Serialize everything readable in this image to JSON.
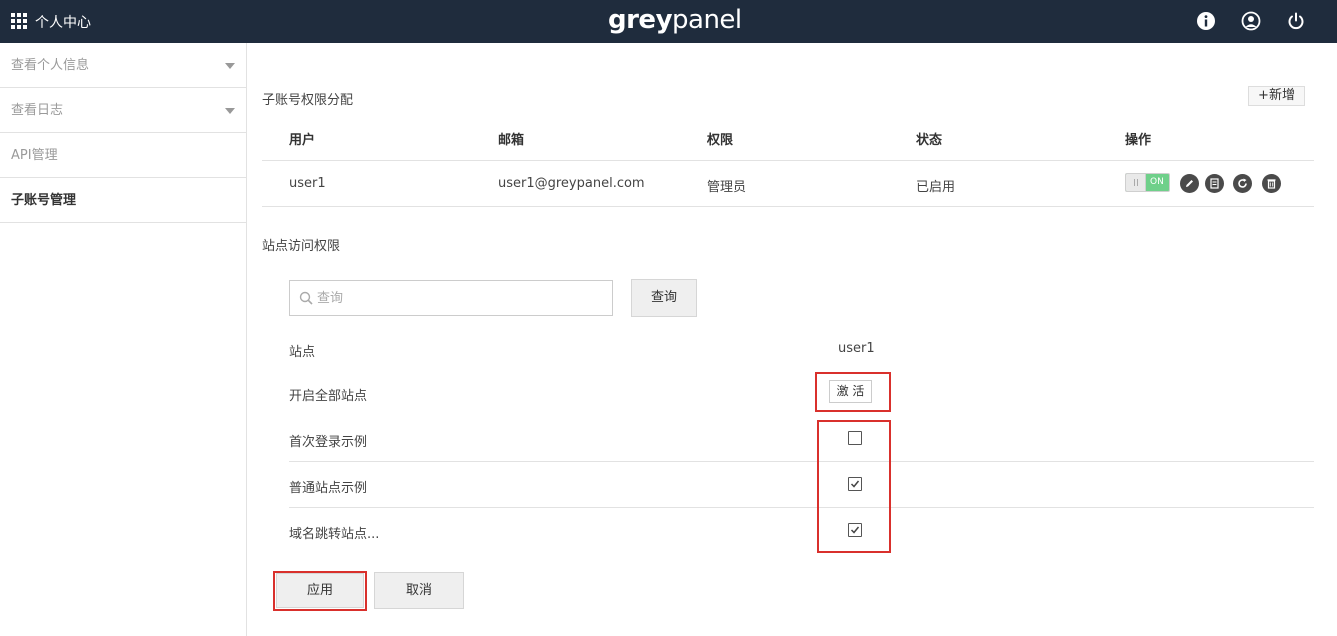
{
  "header": {
    "menu_icon": "grid-icon",
    "title": "个人中心",
    "logo_part1": "grey",
    "logo_part2": "panel",
    "icons": [
      "info-icon",
      "user-icon",
      "power-icon"
    ]
  },
  "sidebar": {
    "items": [
      {
        "label": "查看个人信息",
        "has_caret": true
      },
      {
        "label": "查看日志",
        "has_caret": true
      },
      {
        "label": "API管理",
        "has_caret": false
      },
      {
        "label": "子账号管理",
        "active": true
      }
    ]
  },
  "subaccounts": {
    "title": "子账号权限分配",
    "add_label": "+新增",
    "columns": [
      "用户",
      "邮箱",
      "权限",
      "状态",
      "操作"
    ],
    "rows": [
      {
        "user": "user1",
        "email": "user1@greypanel.com",
        "role": "管理员",
        "status": "已启用",
        "toggle": "ON"
      }
    ],
    "action_icons": [
      "edit-icon",
      "document-icon",
      "refresh-icon",
      "trash-icon"
    ]
  },
  "site_access": {
    "title": "站点访问权限",
    "search_placeholder": "查询",
    "search_value": "",
    "query_label": "查询",
    "site_header": "站点",
    "user_header": "user1",
    "enable_all_label": "开启全部站点",
    "activate_label": "激 活",
    "sites": [
      {
        "name": "首次登录示例",
        "checked": false
      },
      {
        "name": "普通站点示例",
        "checked": true
      },
      {
        "name": "域名跳转站点...",
        "checked": true
      }
    ]
  },
  "footer": {
    "apply_label": "应用",
    "cancel_label": "取消"
  },
  "colors": {
    "topbar": "#1f2c3d",
    "toggle_on": "#6fd08a",
    "highlight": "#d9302c"
  }
}
